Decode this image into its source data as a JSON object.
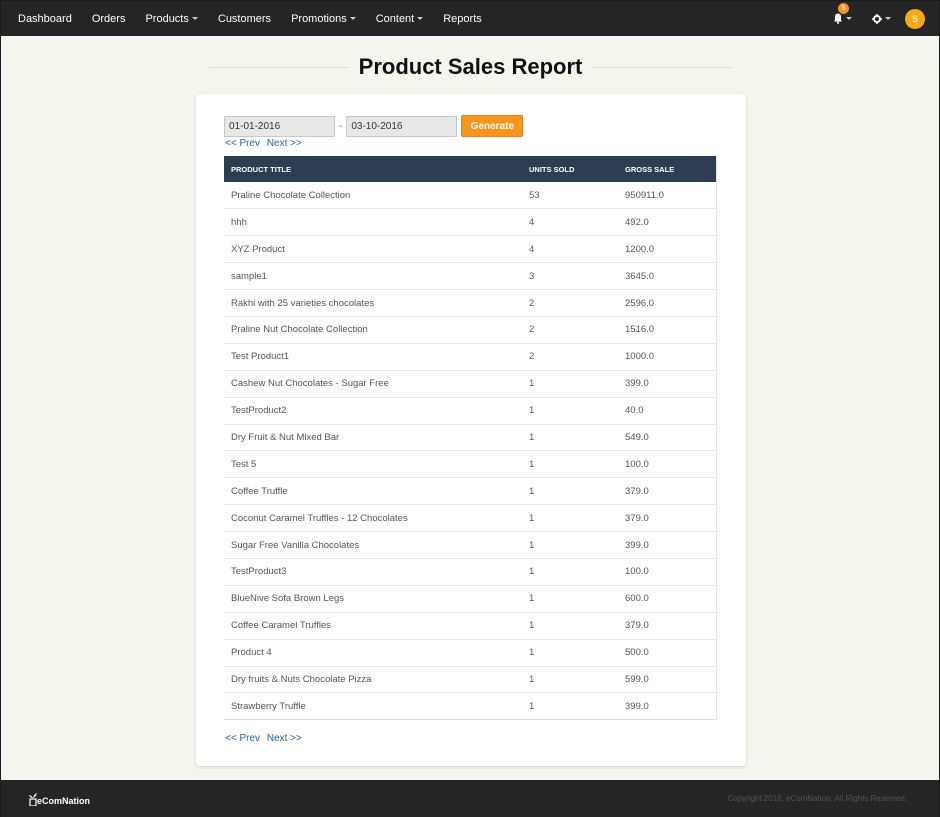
{
  "nav": {
    "items": [
      {
        "label": "Dashboard",
        "dropdown": false
      },
      {
        "label": "Orders",
        "dropdown": false
      },
      {
        "label": "Products",
        "dropdown": true
      },
      {
        "label": "Customers",
        "dropdown": false
      },
      {
        "label": "Promotions",
        "dropdown": true
      },
      {
        "label": "Content",
        "dropdown": true
      },
      {
        "label": "Reports",
        "dropdown": false
      }
    ],
    "notification_count": "5",
    "avatar_initial": "S"
  },
  "page": {
    "title": "Product Sales Report"
  },
  "filters": {
    "start_date": "01-01-2016",
    "separator": "-",
    "end_date": "03-10-2016",
    "generate_label": "Generate"
  },
  "pager": {
    "prev": "<< Prev",
    "next": "Next >>"
  },
  "table": {
    "headers": [
      "PRODUCT TITLE",
      "UNITS SOLD",
      "GROSS SALE"
    ],
    "rows": [
      [
        "Praline Chocolate Collection",
        "53",
        "950911.0"
      ],
      [
        "hhh",
        "4",
        "492.0"
      ],
      [
        "XYZ Product",
        "4",
        "1200.0"
      ],
      [
        "sample1",
        "3",
        "3645.0"
      ],
      [
        "Rakhi with 25 varieties chocolates",
        "2",
        "2596.0"
      ],
      [
        "Praline Nut Chocolate Collection",
        "2",
        "1516.0"
      ],
      [
        "Test Product1",
        "2",
        "1000.0"
      ],
      [
        "Cashew Nut Chocolates - Sugar Free",
        "1",
        "399.0"
      ],
      [
        "TestProduct2",
        "1",
        "40.0"
      ],
      [
        "Dry Fruit & Nut Mixed Bar",
        "1",
        "549.0"
      ],
      [
        "Test 5",
        "1",
        "100.0"
      ],
      [
        "Coffee Truffle",
        "1",
        "379.0"
      ],
      [
        "Coconut Caramel Truffles - 12 Chocolates",
        "1",
        "379.0"
      ],
      [
        "Sugar Free Vanilla Chocolates",
        "1",
        "399.0"
      ],
      [
        "TestProduct3",
        "1",
        "100.0"
      ],
      [
        "BlueNive Sofa Brown Legs",
        "1",
        "600.0"
      ],
      [
        "Coffee Caramel Truffles",
        "1",
        "379.0"
      ],
      [
        "Product 4",
        "1",
        "500.0"
      ],
      [
        "Dry fruits & Nuts Chocolate Pizza",
        "1",
        "599.0"
      ],
      [
        "Strawberry Truffle",
        "1",
        "399.0"
      ]
    ]
  },
  "footer": {
    "logo_text": "eComNation",
    "copyright": "Copyright 2016, eComNation. All Rights Reserved."
  },
  "colors": {
    "navbar": "#252525",
    "accent": "#f7941d",
    "table_header": "#2e3e52",
    "background": "#f5f5ed"
  }
}
